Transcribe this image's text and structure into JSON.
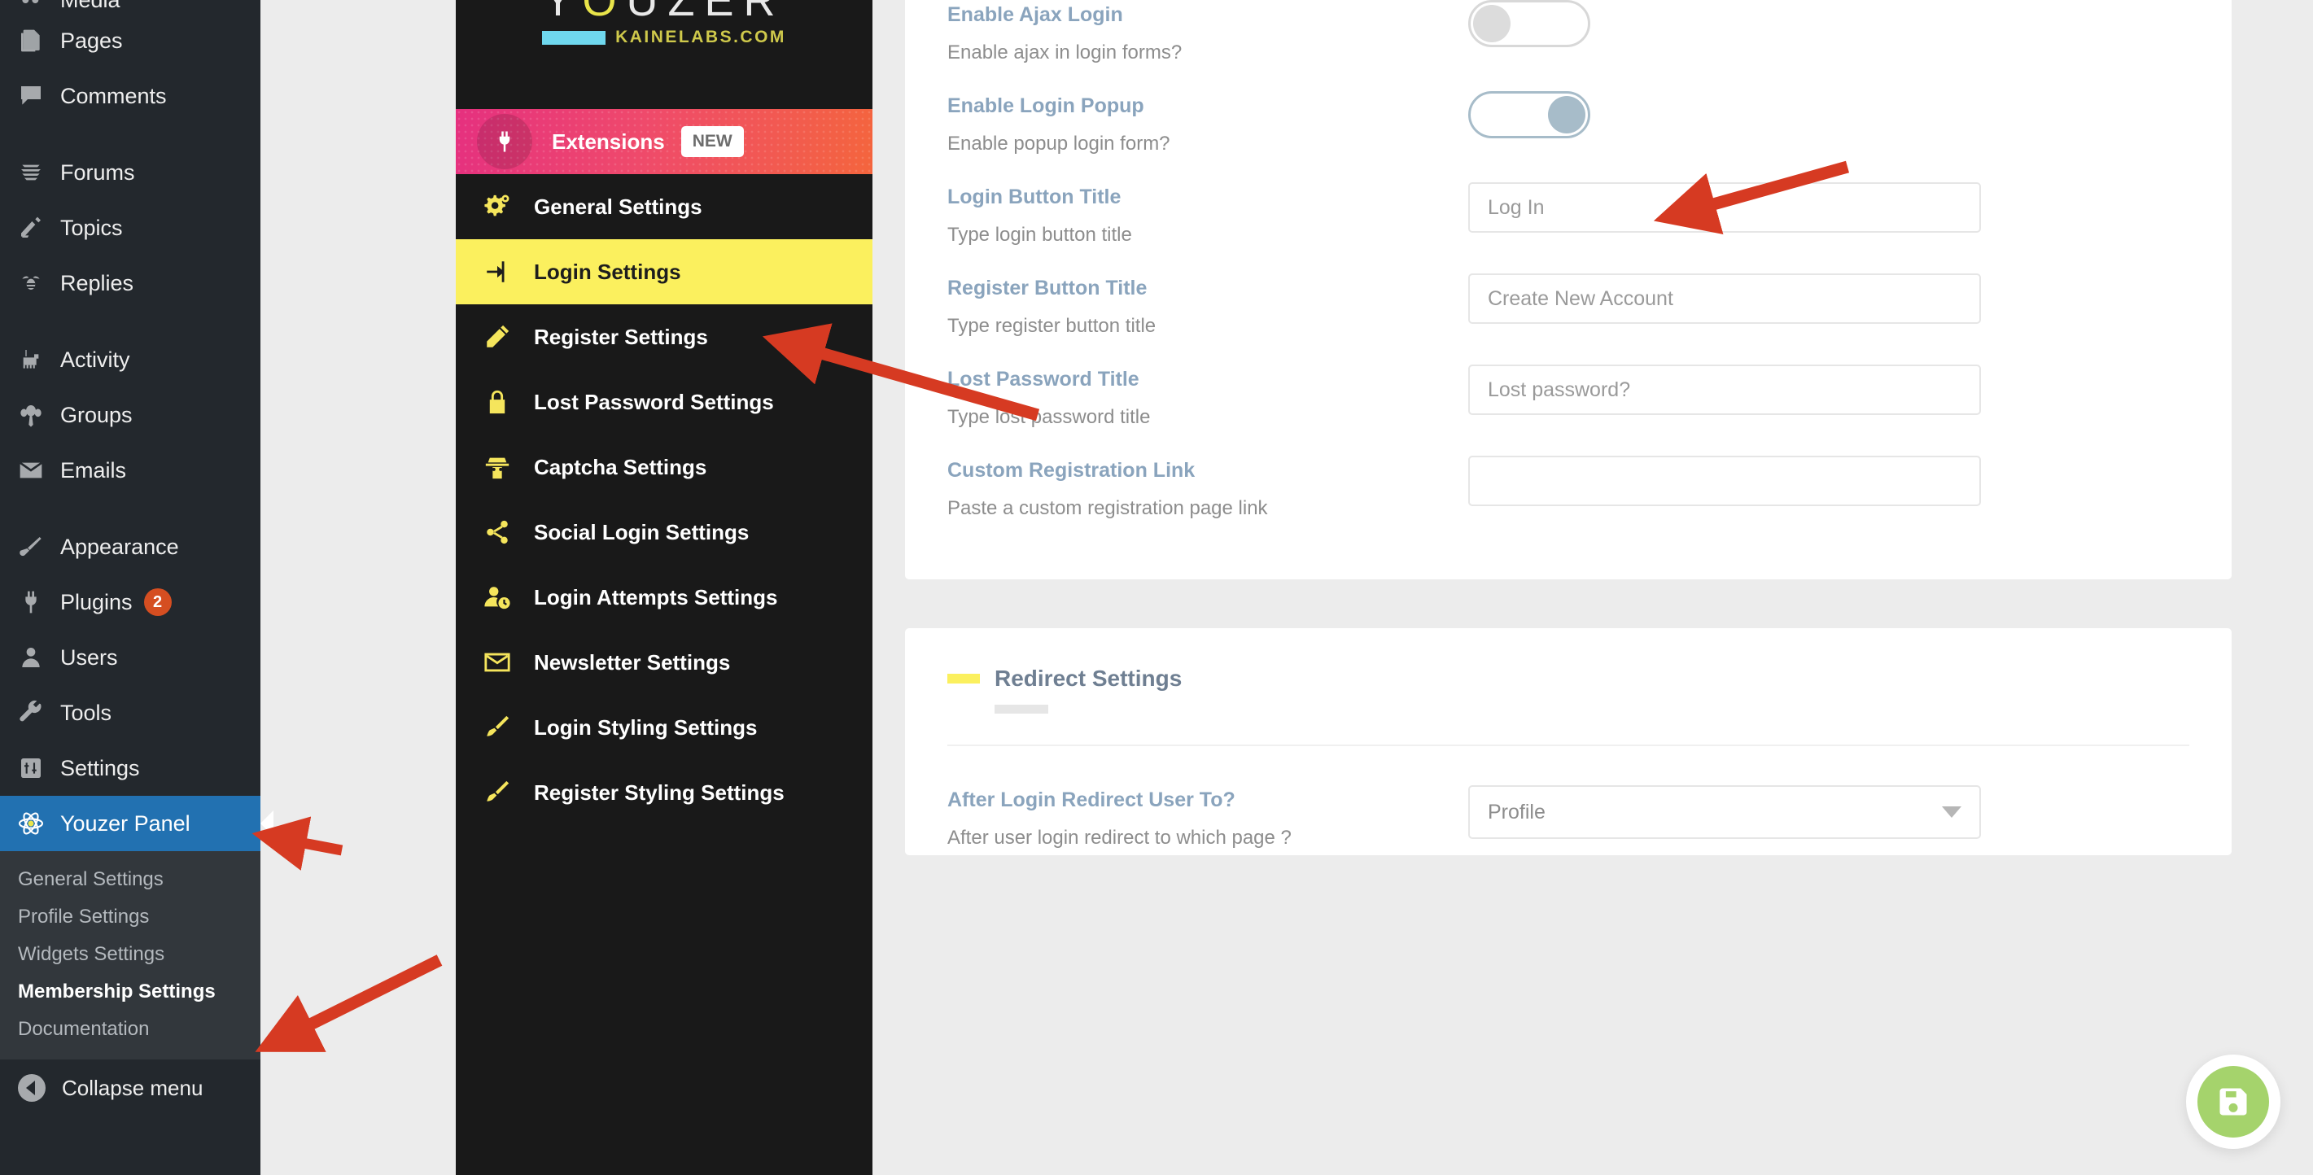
{
  "wp_sidebar": {
    "items": [
      {
        "label": "Media",
        "icon": "media-icon",
        "partial": true
      },
      {
        "label": "Pages",
        "icon": "pages-icon"
      },
      {
        "label": "Comments",
        "icon": "comments-icon"
      },
      {
        "label": "Forums",
        "icon": "forums-icon",
        "gap_before": true
      },
      {
        "label": "Topics",
        "icon": "topics-icon"
      },
      {
        "label": "Replies",
        "icon": "replies-icon"
      },
      {
        "label": "Activity",
        "icon": "activity-icon",
        "gap_before": true
      },
      {
        "label": "Groups",
        "icon": "groups-icon"
      },
      {
        "label": "Emails",
        "icon": "emails-icon"
      },
      {
        "label": "Appearance",
        "icon": "appearance-icon",
        "gap_before": true
      },
      {
        "label": "Plugins",
        "icon": "plugins-icon",
        "badge": "2"
      },
      {
        "label": "Users",
        "icon": "users-icon"
      },
      {
        "label": "Tools",
        "icon": "tools-icon"
      },
      {
        "label": "Settings",
        "icon": "settings-icon"
      }
    ],
    "current": {
      "label": "Youzer Panel",
      "icon": "youzer-atom-icon"
    },
    "submenu": [
      {
        "label": "General Settings",
        "active": false
      },
      {
        "label": "Profile Settings",
        "active": false
      },
      {
        "label": "Widgets Settings",
        "active": false
      },
      {
        "label": "Membership Settings",
        "active": true
      },
      {
        "label": "Documentation",
        "active": false
      }
    ],
    "collapse_label": "Collapse menu"
  },
  "youzer_menu": {
    "logo": {
      "word": "YOUZER",
      "highlight_letter": "O",
      "subtitle": "KAINELABS.COM"
    },
    "extensions": {
      "label": "Extensions",
      "badge": "NEW",
      "icon": "plug-icon"
    },
    "items": [
      {
        "label": "General Settings",
        "icon": "gears-icon",
        "active": false
      },
      {
        "label": "Login Settings",
        "icon": "login-arrow-icon",
        "active": true
      },
      {
        "label": "Register Settings",
        "icon": "pencil-icon",
        "active": false
      },
      {
        "label": "Lost Password Settings",
        "icon": "lock-icon",
        "active": false
      },
      {
        "label": "Captcha Settings",
        "icon": "detective-icon",
        "active": false
      },
      {
        "label": "Social Login Settings",
        "icon": "share-icon",
        "active": false
      },
      {
        "label": "Login Attempts Settings",
        "icon": "user-clock-icon",
        "active": false
      },
      {
        "label": "Newsletter Settings",
        "icon": "envelope-icon",
        "active": false
      },
      {
        "label": "Login Styling Settings",
        "icon": "brush-icon",
        "active": false
      },
      {
        "label": "Register Styling Settings",
        "icon": "brush-icon",
        "active": false
      }
    ]
  },
  "main": {
    "login_rows": [
      {
        "title": "Enable Ajax Login",
        "desc": "Enable ajax in login forms?",
        "control": "toggle",
        "state": "off"
      },
      {
        "title": "Enable Login Popup",
        "desc": "Enable popup login form?",
        "control": "toggle",
        "state": "on"
      },
      {
        "title": "Login Button Title",
        "desc": "Type login button title",
        "control": "text",
        "value": "Log In"
      },
      {
        "title": "Register Button Title",
        "desc": "Type register button title",
        "control": "text",
        "value": "Create New Account"
      },
      {
        "title": "Lost Password Title",
        "desc": "Type lost password title",
        "control": "text",
        "value": "Lost password?"
      },
      {
        "title": "Custom Registration Link",
        "desc": "Paste a custom registration page link",
        "control": "text",
        "value": ""
      }
    ],
    "redirect_section": {
      "title": "Redirect Settings",
      "rows": [
        {
          "title": "After Login Redirect User To?",
          "desc": "After user login redirect to which page ?",
          "control": "select",
          "value": "Profile"
        }
      ]
    },
    "save_button": {
      "icon": "save-floppy-icon",
      "color": "#a5d36c"
    }
  },
  "annotations": {
    "arrow_color": "#d63a22",
    "arrows": [
      {
        "target": "enable-login-popup-toggle"
      },
      {
        "target": "login-settings-menu-item"
      },
      {
        "target": "youzer-panel-sidebar-item"
      },
      {
        "target": "membership-settings-submenu-item"
      }
    ]
  }
}
